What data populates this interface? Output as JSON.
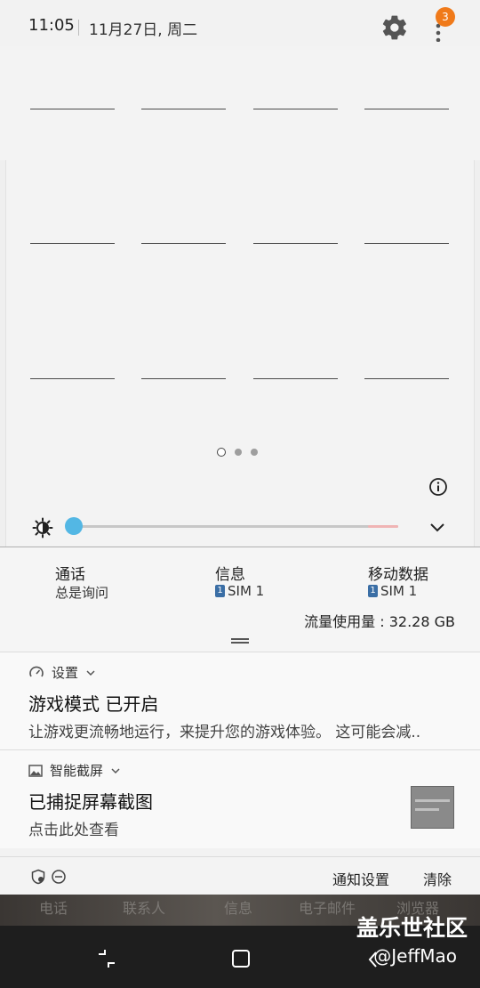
{
  "header": {
    "time": "11:05",
    "date": "11月27日, 周二",
    "settings_icon": "gear-icon",
    "more_icon": "more-vert-icon",
    "badge_count": "3"
  },
  "tiles": {
    "page_indicator": {
      "pages": 3,
      "active": 1
    }
  },
  "brightness": {
    "level": 0.0
  },
  "shortcuts": {
    "call": {
      "title": "通话",
      "sub": "总是询问"
    },
    "message": {
      "title": "信息",
      "sim_label": "SIM 1",
      "sim_number": "1"
    },
    "mobile_data": {
      "title": "移动数据",
      "sim_label": "SIM 1",
      "sim_number": "1"
    },
    "data_usage": "流量使用量 : 32.28 GB"
  },
  "notifications": [
    {
      "app": "设置",
      "title": "游戏模式 已开启",
      "body": "让游戏更流畅地运行，来提升您的游戏体验。 这可能会减.."
    },
    {
      "app": "智能截屏",
      "title": "已捕捉屏幕截图",
      "body": "点击此处查看"
    }
  ],
  "actions": {
    "notification_settings": "通知设置",
    "clear": "清除"
  },
  "background_apps": [
    "电话",
    "联系人",
    "信息",
    "电子邮件",
    "浏览器"
  ],
  "watermark": {
    "title": "盖乐世社区",
    "author": "@JeffMao"
  },
  "colors": {
    "accent": "#53b7e4",
    "badge": "#f07a1a",
    "sim": "#3a6ea5"
  }
}
